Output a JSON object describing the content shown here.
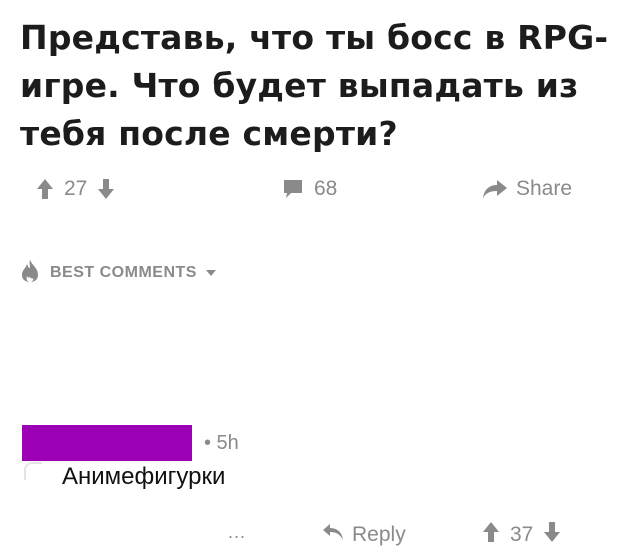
{
  "post": {
    "title": "Представь, что ты босс в RPG-игре. Что будет выпадать из тебя после смерти?",
    "vote_count": "27",
    "comment_count": "68",
    "share_label": "Share"
  },
  "comments_section": {
    "sort_label": "BEST COMMENTS"
  },
  "comment": {
    "redaction_color": "#9b00b4",
    "age": "• 5h",
    "text": "Анимефигурки",
    "more_label": "...",
    "reply_label": "Reply",
    "vote_count": "37"
  },
  "icons": {
    "upvote": "arrow-up-icon",
    "downvote": "arrow-down-icon",
    "comment": "speech-bubble-icon",
    "share": "share-arrow-icon",
    "best": "flame-icon",
    "sort": "caret-down-icon",
    "reply": "reply-arrow-icon"
  }
}
